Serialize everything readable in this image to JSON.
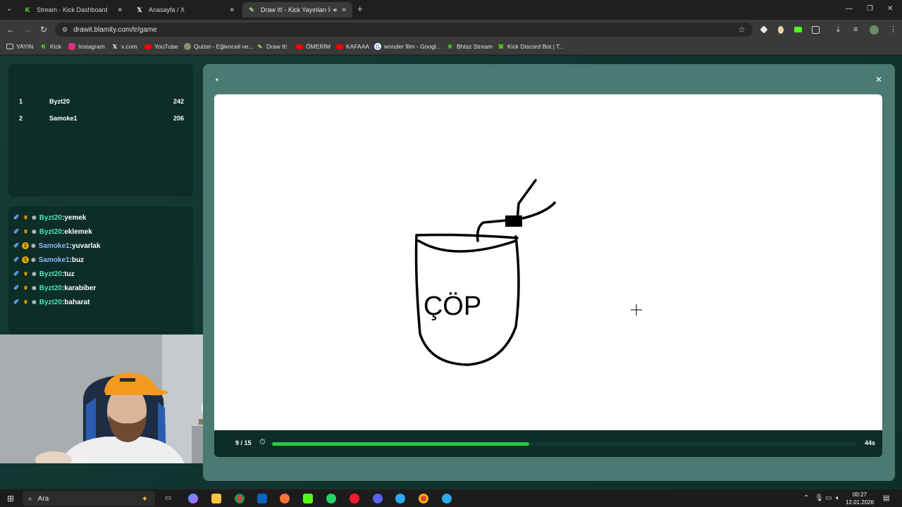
{
  "browser": {
    "tabs": [
      {
        "label": "Stream - Kick Dashboard",
        "icon": "kick-icon",
        "active": false
      },
      {
        "label": "Anasayfa / X",
        "icon": "x-icon",
        "active": false
      },
      {
        "label": "Draw It! - Kick Yayınları İçin",
        "icon": "drawit-icon",
        "active": true
      }
    ],
    "new_tab": "+",
    "url": "drawit.blamity.com/tr/game"
  },
  "bookmarks": [
    {
      "label": "YAYIN",
      "icon": "folder-icon"
    },
    {
      "label": "Kick",
      "icon": "kick-icon"
    },
    {
      "label": "Instagram",
      "icon": "instagram-icon"
    },
    {
      "label": "x.com",
      "icon": "x-icon"
    },
    {
      "label": "YouTube",
      "icon": "youtube-icon"
    },
    {
      "label": "Quizei - Eğlenceli ve...",
      "icon": "quizei-icon"
    },
    {
      "label": "Draw It!",
      "icon": "drawit-icon"
    },
    {
      "label": "ÖMERİM",
      "icon": "youtube-icon"
    },
    {
      "label": "KAFAAA",
      "icon": "youtube-icon"
    },
    {
      "label": "wonder film - Googl...",
      "icon": "google-icon"
    },
    {
      "label": "Bhtsz Stream",
      "icon": "kick-icon"
    },
    {
      "label": "Kick Discord Bot | T...",
      "icon": "bot-icon"
    }
  ],
  "scoreboard": [
    {
      "rank": "1",
      "name": "Byzt20",
      "score": "242"
    },
    {
      "rank": "2",
      "name": "Samoke1",
      "score": "206"
    }
  ],
  "chat": [
    {
      "user": "Byzt20",
      "message": "yemek",
      "badge": "crown"
    },
    {
      "user": "Byzt20",
      "message": "eklemek",
      "badge": "crown"
    },
    {
      "user": "Samoke1",
      "message": "yuvarlak",
      "badge": "one"
    },
    {
      "user": "Samoke1",
      "message": "buz",
      "badge": "one"
    },
    {
      "user": "Byzt20",
      "message": "tuz",
      "badge": "crown"
    },
    {
      "user": "Byzt20",
      "message": "karabiber",
      "badge": "crown"
    },
    {
      "user": "Byzt20",
      "message": "baharat",
      "badge": "crown"
    }
  ],
  "drawing_text": "ÇÖP",
  "game": {
    "round": "9 / 15",
    "seconds_left": "44s",
    "progress_fraction": 0.44
  },
  "taskbar": {
    "search_placeholder": "Ara",
    "time": "00:27",
    "date": "12.01.2026"
  },
  "colors": {
    "progress": "#27c93f",
    "kick_green": "#53fc18",
    "page_bg": "#173b34"
  }
}
